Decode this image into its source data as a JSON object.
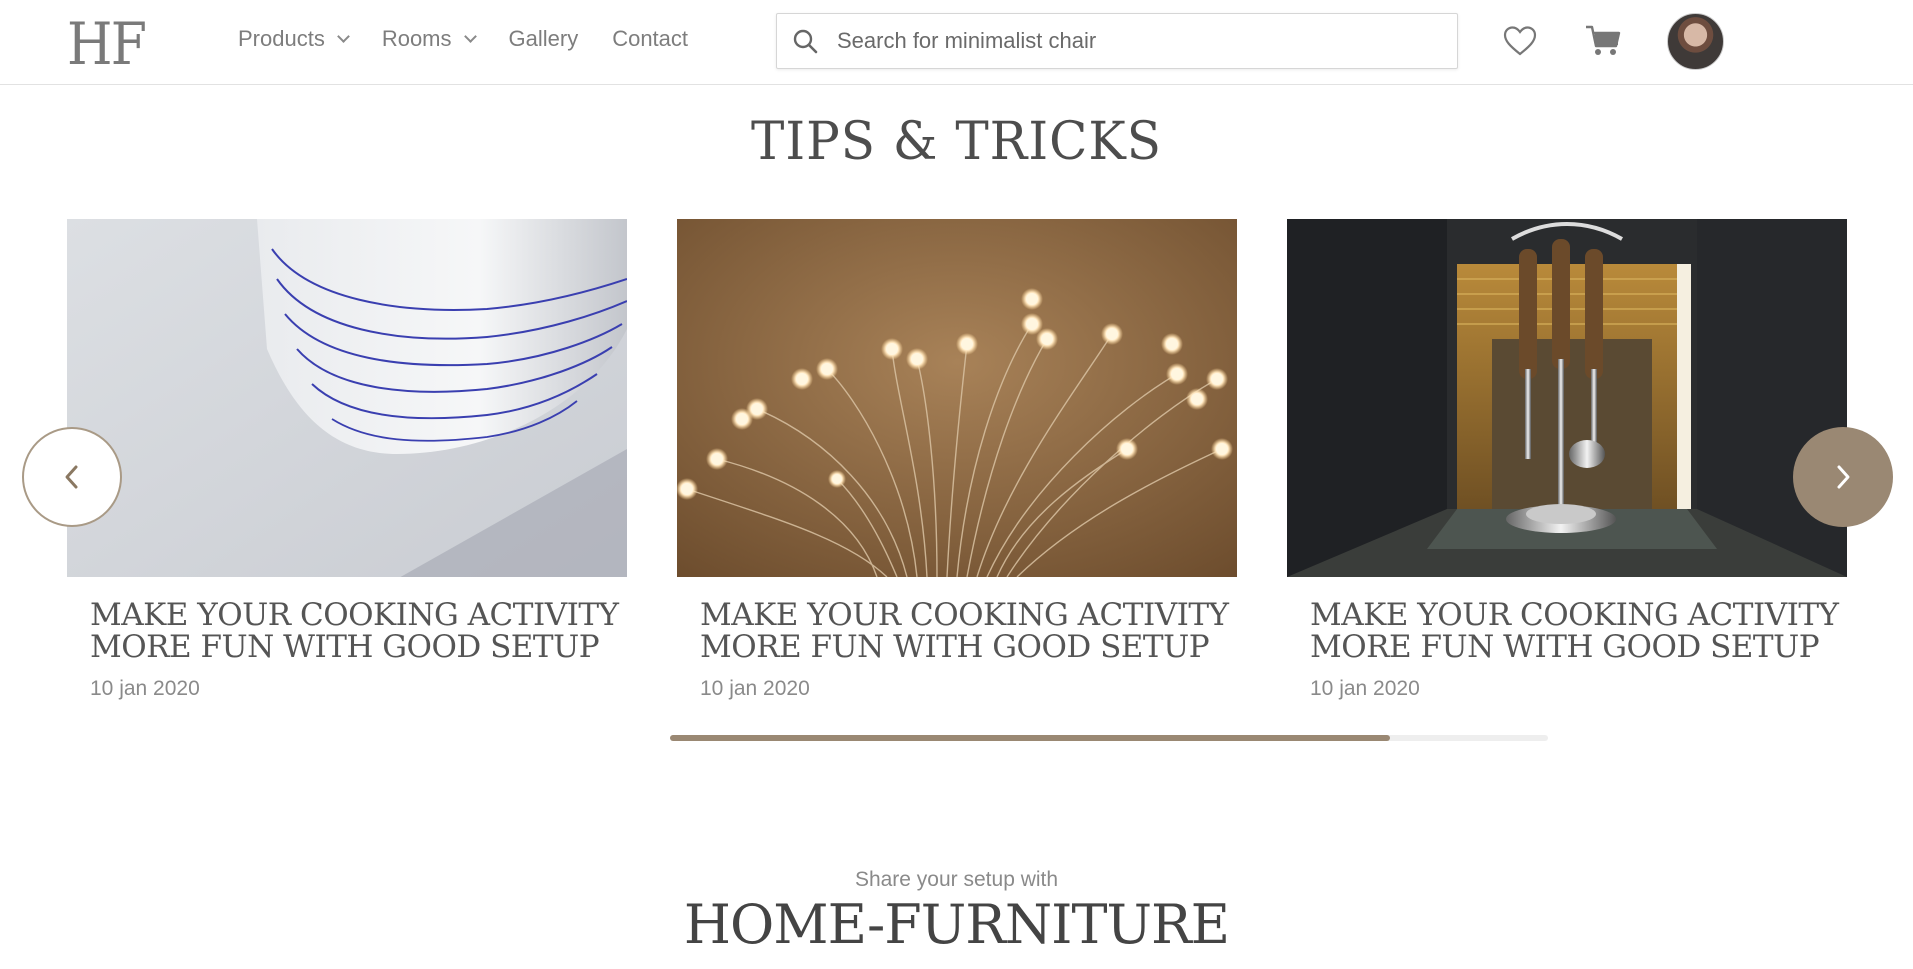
{
  "header": {
    "logo": "HF",
    "nav": [
      {
        "label": "Products",
        "has_dropdown": true
      },
      {
        "label": "Rooms",
        "has_dropdown": true
      },
      {
        "label": "Gallery",
        "has_dropdown": false
      },
      {
        "label": "Contact",
        "has_dropdown": false
      }
    ],
    "search": {
      "placeholder": "Search for minimalist chair",
      "value": ""
    },
    "icons": {
      "wishlist": "heart-icon",
      "cart": "cart-icon",
      "avatar": "user-avatar"
    }
  },
  "tips": {
    "title": "TIPS & TRICKS",
    "cards": [
      {
        "title": "MAKE YOUR COOKING ACTIVITY MORE FUN WITH GOOD SETUP",
        "date": "10 jan 2020",
        "image": "white vase with blue stripes"
      },
      {
        "title": "MAKE YOUR COOKING ACTIVITY MORE FUN WITH GOOD SETUP",
        "date": "10 jan 2020",
        "image": "fiber optic light bulbs"
      },
      {
        "title": "MAKE YOUR COOKING ACTIVITY MORE FUN WITH GOOD SETUP",
        "date": "10 jan 2020",
        "image": "chrome utensil stand on shelf"
      }
    ],
    "carousel_progress": 0.82
  },
  "footer_promo": {
    "share_text": "Share your setup with",
    "brand": "HOME-FURNITURE"
  },
  "colors": {
    "accent": "#9a8873",
    "text": "#4a4a4a",
    "muted": "#8a8a8a"
  }
}
